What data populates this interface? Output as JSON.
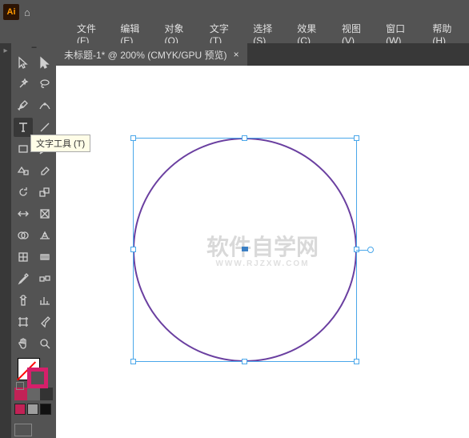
{
  "app": {
    "logo": "Ai"
  },
  "menu": {
    "file": {
      "label": "文件",
      "key": "F"
    },
    "edit": {
      "label": "编辑",
      "key": "E"
    },
    "object": {
      "label": "对象",
      "key": "O"
    },
    "text": {
      "label": "文字",
      "key": "T"
    },
    "select": {
      "label": "选择",
      "key": "S"
    },
    "effect": {
      "label": "效果",
      "key": "C"
    },
    "view": {
      "label": "视图",
      "key": "V"
    },
    "window": {
      "label": "窗口",
      "key": "W"
    },
    "help": {
      "label": "帮助",
      "key": "H"
    }
  },
  "tab": {
    "title": "未标题-1* @ 200% (CMYK/GPU 预览)",
    "close": "×"
  },
  "tooltip": {
    "type_tool": "文字工具 (T)"
  },
  "colors": {
    "stroke_swatch": "#d61f6a",
    "swatches": [
      "#c22256",
      "#9e9e9e",
      "#111111"
    ],
    "mode": [
      "#c22256",
      "#666666",
      "#333333"
    ]
  },
  "watermark": {
    "main": "软件自学网",
    "sub": "WWW.RJZXW.COM"
  },
  "shape": {
    "type": "ellipse",
    "stroke": "#6a3fa0",
    "fill": "none",
    "selected": true
  }
}
